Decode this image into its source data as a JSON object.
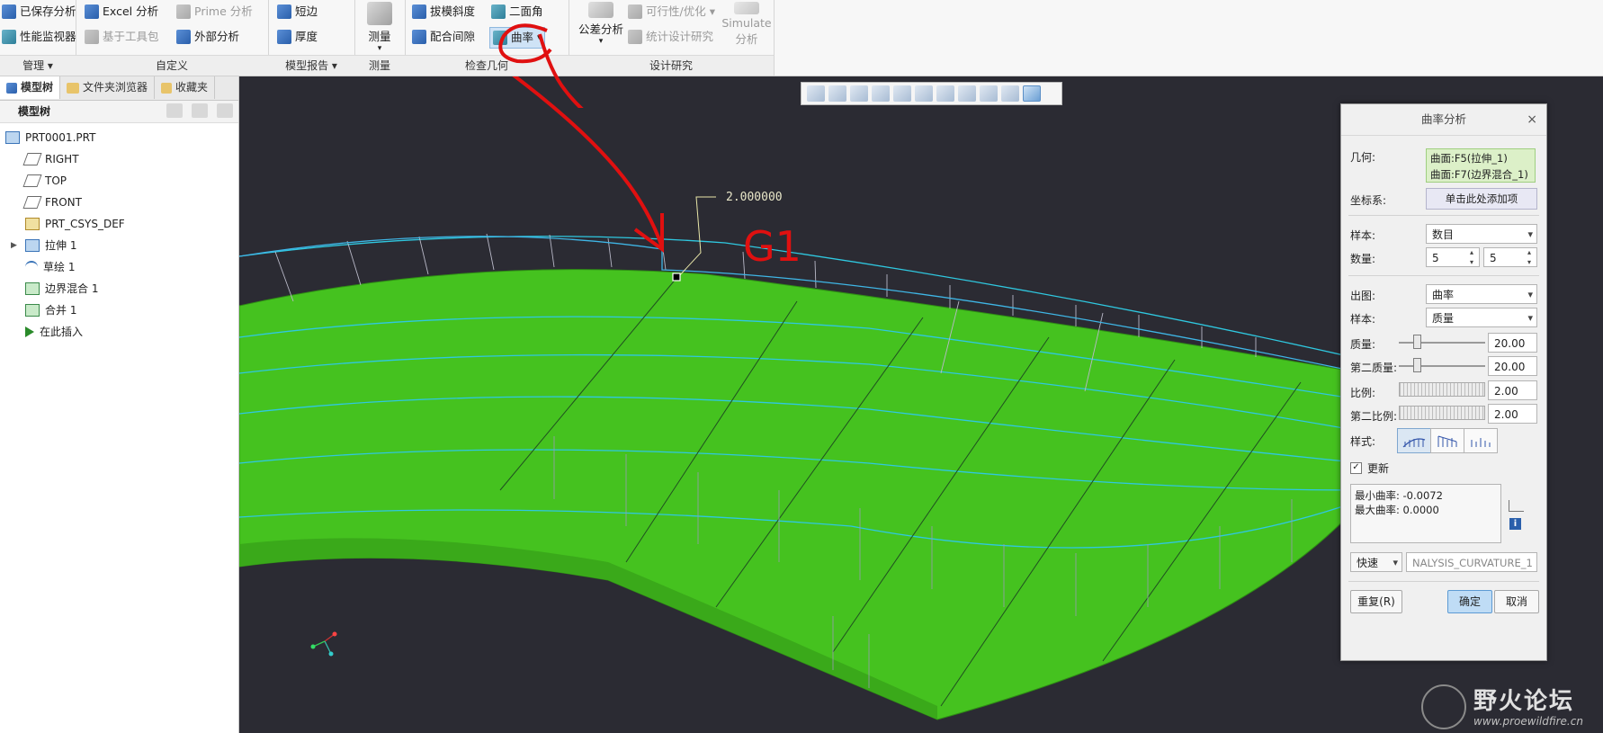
{
  "ribbon": {
    "groups": [
      {
        "label": "管理",
        "items": [
          "已保存分析",
          "性能监视器"
        ]
      },
      {
        "label": "自定义",
        "items": [
          "Excel 分析",
          "Prime 分析",
          "基于工具包",
          "外部分析"
        ]
      },
      {
        "label": "模型报告",
        "items": [
          "短边",
          "厚度"
        ]
      },
      {
        "label": "测量",
        "items": [
          "测量"
        ]
      },
      {
        "label": "检查几何",
        "items": [
          "拔模斜度",
          "二面角",
          "配合间隙",
          "曲率"
        ]
      },
      {
        "label": "设计研究",
        "items": [
          "公差分析",
          "可行性/优化",
          "统计设计研究",
          "Simulate",
          "分析"
        ]
      }
    ]
  },
  "left_panel": {
    "tabs": [
      "模型树",
      "文件夹浏览器",
      "收藏夹"
    ],
    "tree_title": "模型树",
    "items": [
      {
        "label": "PRT0001.PRT",
        "icon": "part-icon"
      },
      {
        "label": "RIGHT",
        "icon": "datum-plane-icon"
      },
      {
        "label": "TOP",
        "icon": "datum-plane-icon"
      },
      {
        "label": "FRONT",
        "icon": "datum-plane-icon"
      },
      {
        "label": "PRT_CSYS_DEF",
        "icon": "csys-icon"
      },
      {
        "label": "拉伸 1",
        "icon": "extrude-icon"
      },
      {
        "label": "草绘 1",
        "icon": "sketch-icon"
      },
      {
        "label": "边界混合 1",
        "icon": "boundary-blend-icon"
      },
      {
        "label": "合并 1",
        "icon": "merge-icon"
      },
      {
        "label": "在此插入",
        "icon": "insert-here-icon"
      }
    ]
  },
  "viewport": {
    "dimension": "2.000000",
    "annotation": "G1"
  },
  "dialog": {
    "title": "曲率分析",
    "close": "×",
    "geometry_label": "几何:",
    "geometry_values": [
      "曲面:F5(拉伸_1)",
      "曲面:F7(边界混合_1)"
    ],
    "csys_label": "坐标系:",
    "csys_placeholder": "单击此处添加项",
    "sample_label": "样本:",
    "sample_value": "数目",
    "count_label": "数量:",
    "count_u": "5",
    "count_v": "5",
    "output_label": "出图:",
    "output_value": "曲率",
    "sample2_label": "样本:",
    "sample2_value": "质量",
    "quality_label": "质量:",
    "quality_value": "20.00",
    "quality2_label": "第二质量:",
    "quality2_value": "20.00",
    "scale_label": "比例:",
    "scale_value": "2.00",
    "scale2_label": "第二比例:",
    "scale2_value": "2.00",
    "style_label": "样式:",
    "update_label": "更新",
    "min_curv": "最小曲率: -0.0072",
    "max_curv": "最大曲率: 0.0000",
    "mode_value": "快速",
    "analysis_name": "NALYSIS_CURVATURE_1",
    "repeat_btn": "重复(R)",
    "ok_btn": "确定",
    "cancel_btn": "取消"
  },
  "watermark": {
    "title": "野火论坛",
    "url": "www.proewildfire.cn"
  }
}
